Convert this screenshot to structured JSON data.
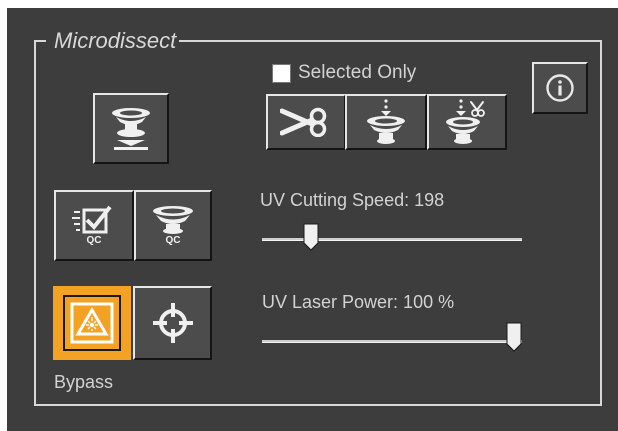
{
  "group_title": "Microdissect",
  "selected_only": {
    "label": "Selected Only",
    "checked": false
  },
  "info_icon": "info-icon",
  "buttons": {
    "stage": {
      "icon": "stage-lower-icon"
    },
    "cut": {
      "icon": "scissors-icon"
    },
    "drop": {
      "icon": "drop-to-cap-icon"
    },
    "cut_drop": {
      "icon": "cut-and-drop-icon"
    },
    "qc_check": {
      "icon": "qc-checklist-icon",
      "label": "QC"
    },
    "qc_cap": {
      "icon": "qc-cap-icon",
      "label": "QC"
    },
    "bypass": {
      "icon": "laser-bypass-icon",
      "active": true
    },
    "target": {
      "icon": "crosshair-icon"
    }
  },
  "speed": {
    "label": "UV Cutting Speed: 198",
    "value": 198,
    "fraction": 0.17
  },
  "power": {
    "label": "UV Laser Power: 100 %",
    "value": 100,
    "fraction": 1.0
  },
  "bypass_label": "Bypass",
  "colors": {
    "panel": "#3d3d3d",
    "active": "#f4a224",
    "text": "#d2d2d2"
  }
}
